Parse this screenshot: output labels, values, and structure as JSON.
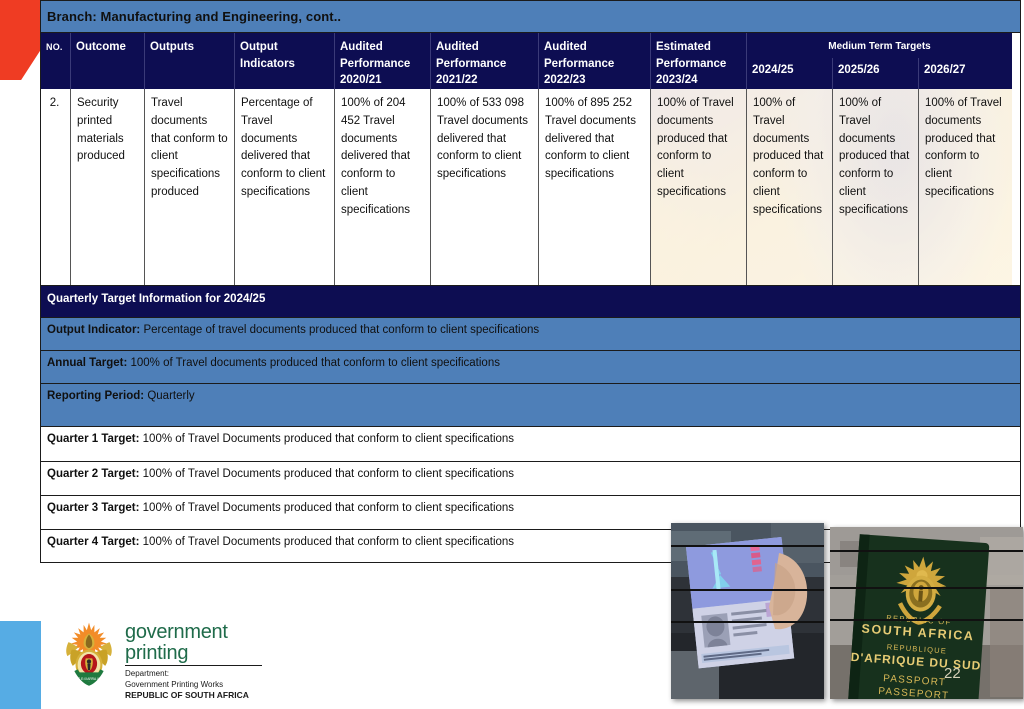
{
  "slide": {
    "title": "Branch: Manufacturing and Engineering, cont..",
    "page_number": "22",
    "accent_red": "#ef3c23",
    "accent_blue": "#56ace4",
    "header_navy": "#0d0d52",
    "header_blue": "#4e7fb8"
  },
  "table": {
    "headers": {
      "no": "NO.",
      "outcome": "Outcome",
      "outputs": "Outputs",
      "output_indicators": "Output Indicators",
      "audited_2020_21": "Audited Performance 2020/21",
      "audited_2021_22": "Audited Performance 2021/22",
      "audited_2022_23": "Audited Performance 2022/23",
      "estimated_2023_24": "Estimated Performance 2023/24",
      "medium_term_targets": "Medium Term Targets",
      "mtt_2024_25": "2024/25",
      "mtt_2025_26": "2025/26",
      "mtt_2026_27": "2026/27"
    },
    "rows": [
      {
        "no": "2.",
        "outcome": "Security printed materials produced",
        "outputs": "Travel documents that conform to client specifications produced",
        "output_indicators": "Percentage of Travel documents delivered that conform to client specifications",
        "audited_2020_21": "100% of 204 452  Travel documents delivered that conform to client specifications",
        "audited_2021_22": "100% of 533 098 Travel documents delivered that conform to  client specifications",
        "audited_2022_23": "100% of 895 252 Travel documents delivered that conform to client specifications",
        "estimated_2023_24": "100% of Travel documents produced that conform to client specifications",
        "mtt_2024_25": "100% of Travel documents produced that conform to client specifications",
        "mtt_2025_26": "100% of Travel documents produced that conform to client specifications",
        "mtt_2026_27": "100% of Travel documents produced that conform to client specifications"
      }
    ]
  },
  "quarterly": {
    "section_title": "Quarterly Target Information for 2024/25",
    "rows": [
      {
        "label": "Output Indicator:",
        "value": "Percentage of travel documents produced that conform to client specifications"
      },
      {
        "label": "Annual Target:",
        "value": "100% of Travel documents produced that conform to client specifications"
      },
      {
        "label": "Reporting Period:",
        "value": "Quarterly"
      },
      {
        "label": "Quarter 1 Target:",
        "value": "100% of Travel Documents produced that conform to client specifications"
      },
      {
        "label": "Quarter 2 Target:",
        "value": "100% of Travel Documents produced that conform to client specifications"
      },
      {
        "label": "Quarter 3 Target:",
        "value": "100% of Travel Documents produced that conform to client specifications"
      },
      {
        "label": "Quarter 4 Target:",
        "value": "100% of Travel Documents produced that conform to client specifications"
      }
    ]
  },
  "footer": {
    "logo_line1": "government",
    "logo_line2": "printing",
    "department_label": "Department:",
    "department_name": "Government Printing Works",
    "country": "REPUBLIC OF SOUTH AFRICA"
  },
  "photos": {
    "uv_passport_caption": "passport-under-uv-light-photo",
    "cover_caption": "south-african-passport-cover-photo",
    "cover_text": {
      "republic_of": "REPUBLIC OF",
      "south_africa": "SOUTH AFRICA",
      "republique": "REPUBLIQUE",
      "dafrique": "D'AFRIQUE DU SUD",
      "passport": "PASSPORT",
      "passeport": "PASSEPORT"
    }
  }
}
